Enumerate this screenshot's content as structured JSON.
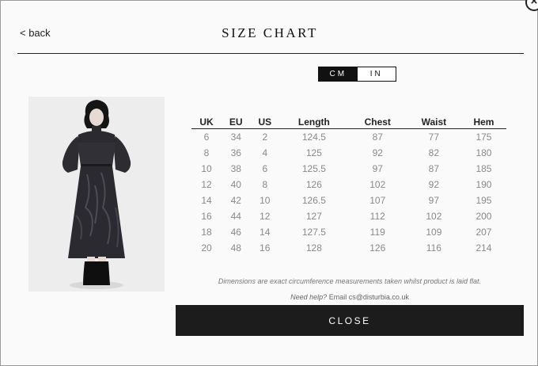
{
  "modal": {
    "back_label": "< back",
    "title": "SIZE CHART",
    "close_icon": "close-circle-icon"
  },
  "unit_toggle": {
    "cm_label": "CM",
    "in_label": "IN",
    "selected": "CM"
  },
  "table": {
    "headers": [
      "UK",
      "EU",
      "US",
      "Length",
      "Chest",
      "Waist",
      "Hem"
    ],
    "rows": [
      [
        "6",
        "34",
        "2",
        "124.5",
        "87",
        "77",
        "175"
      ],
      [
        "8",
        "36",
        "4",
        "125",
        "92",
        "82",
        "180"
      ],
      [
        "10",
        "38",
        "6",
        "125.5",
        "97",
        "87",
        "185"
      ],
      [
        "12",
        "40",
        "8",
        "126",
        "102",
        "92",
        "190"
      ],
      [
        "14",
        "42",
        "10",
        "126.5",
        "107",
        "97",
        "195"
      ],
      [
        "16",
        "44",
        "12",
        "127",
        "112",
        "102",
        "200"
      ],
      [
        "18",
        "46",
        "14",
        "127.5",
        "119",
        "109",
        "207"
      ],
      [
        "20",
        "48",
        "16",
        "128",
        "126",
        "116",
        "214"
      ]
    ]
  },
  "footer": {
    "note": "Dimensions are exact circumference measurements taken whilst product is laid flat.",
    "help_prefix": "Need help?",
    "help_email": "Email cs@disturbia.co.uk",
    "close_label": "CLOSE"
  }
}
